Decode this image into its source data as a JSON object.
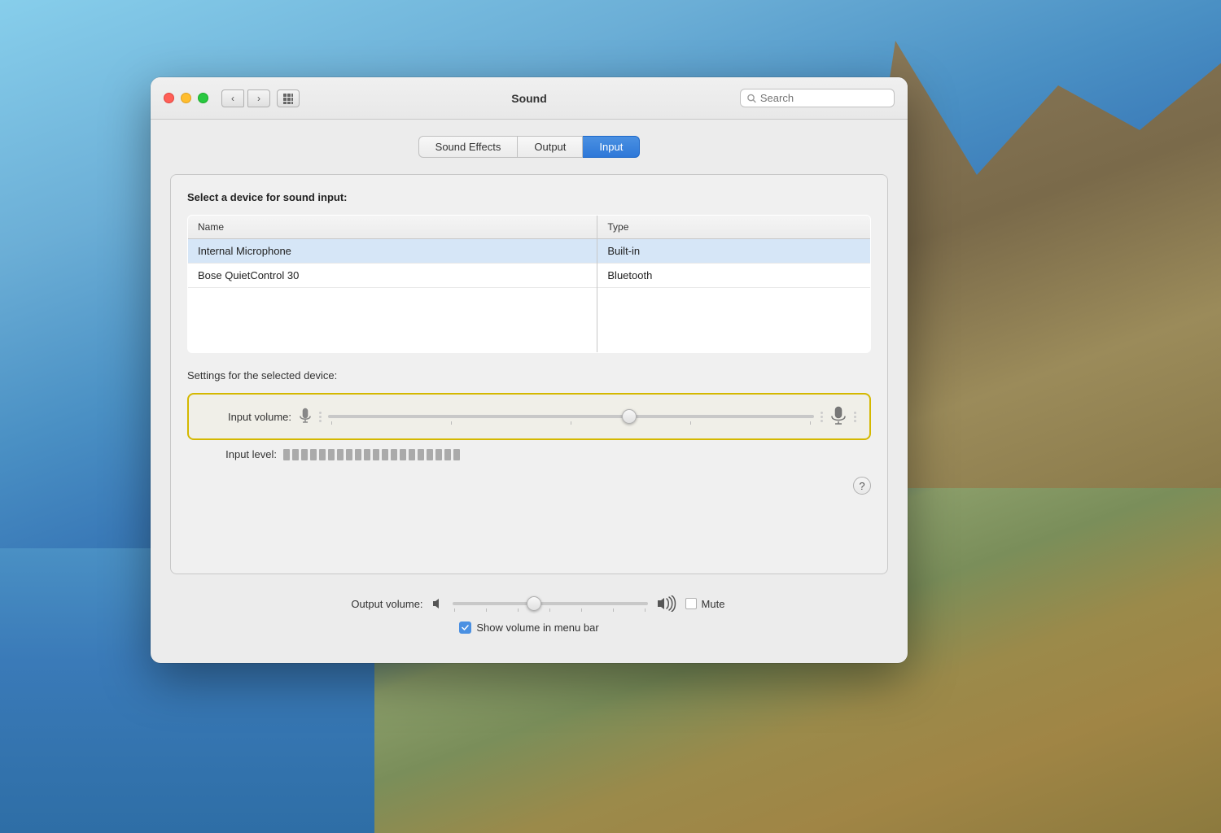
{
  "desktop": {
    "bg_description": "macOS Big Sur desktop with mountains and ocean"
  },
  "window": {
    "title": "Sound",
    "traffic_lights": {
      "close_label": "close",
      "minimize_label": "minimize",
      "maximize_label": "maximize"
    },
    "nav": {
      "back_label": "‹",
      "forward_label": "›",
      "grid_label": "⊞"
    },
    "search": {
      "placeholder": "Search"
    }
  },
  "tabs": [
    {
      "id": "sound-effects",
      "label": "Sound Effects",
      "active": false
    },
    {
      "id": "output",
      "label": "Output",
      "active": false
    },
    {
      "id": "input",
      "label": "Input",
      "active": true
    }
  ],
  "panel": {
    "device_section": {
      "title": "Select a device for sound input:",
      "columns": [
        "Name",
        "Type"
      ],
      "devices": [
        {
          "name": "Internal Microphone",
          "type": "Built-in"
        },
        {
          "name": "Bose QuietControl 30",
          "type": "Bluetooth"
        }
      ]
    },
    "settings_section": {
      "label": "Settings for the selected device:",
      "input_volume_label": "Input volume:",
      "input_level_label": "Input level:",
      "slider_position_percent": 62
    }
  },
  "bottom": {
    "output_volume_label": "Output volume:",
    "output_slider_percent": 42,
    "mute_label": "Mute",
    "show_volume_label": "Show volume in menu bar",
    "show_volume_checked": true
  },
  "help": {
    "label": "?"
  }
}
